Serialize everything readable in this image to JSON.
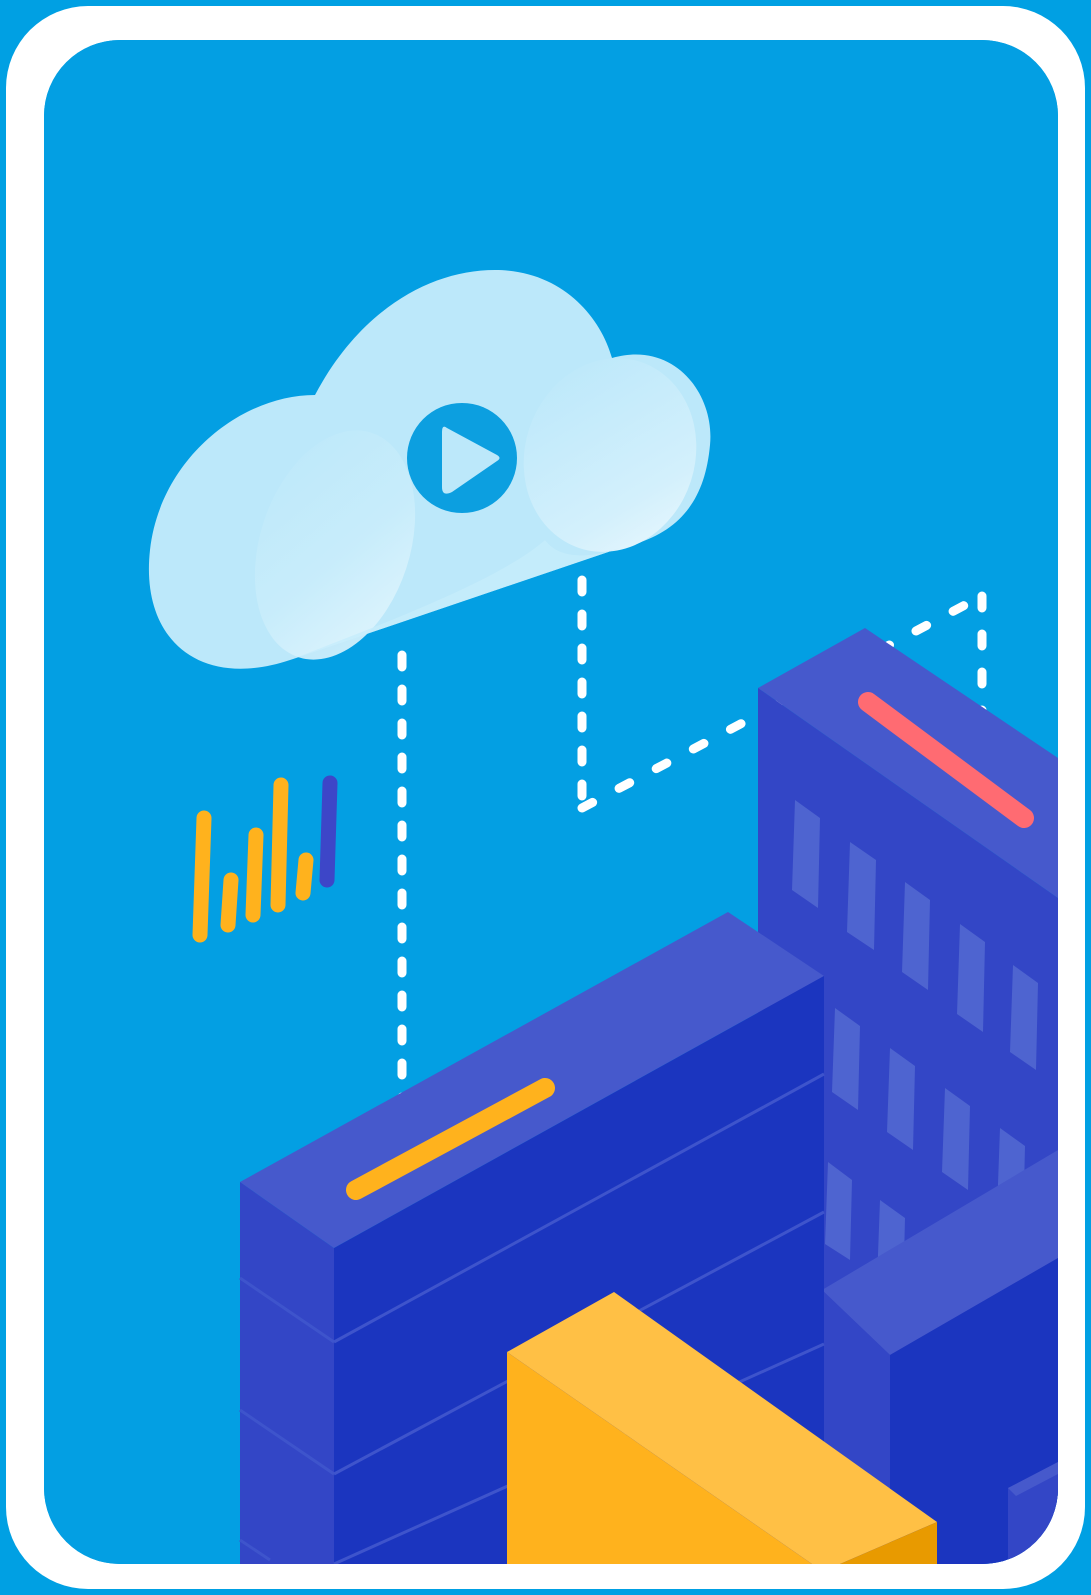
{
  "illustration": {
    "icons": {
      "cloud": "cloud-icon",
      "play": "play-icon",
      "bars": "bar-chart-icon"
    },
    "colors": {
      "outer_background": "#00A0E3",
      "frame": "#FFFFFF",
      "card_background": "#039FE3",
      "cloud": "#BCE8FA",
      "play_icon": "#0C9FE0",
      "connector_lines": "#FFFFFF",
      "building_top": "#4659CC",
      "building_left": "#3346C6",
      "building_right": "#1B35BF",
      "window": "#4E64D0",
      "accent_orange": "#FFB21D",
      "accent_orange_light": "#FFC045",
      "accent_orange_dark": "#E89A00",
      "accent_red": "#FF6B72",
      "accent_purple": "#3D46C8"
    }
  }
}
